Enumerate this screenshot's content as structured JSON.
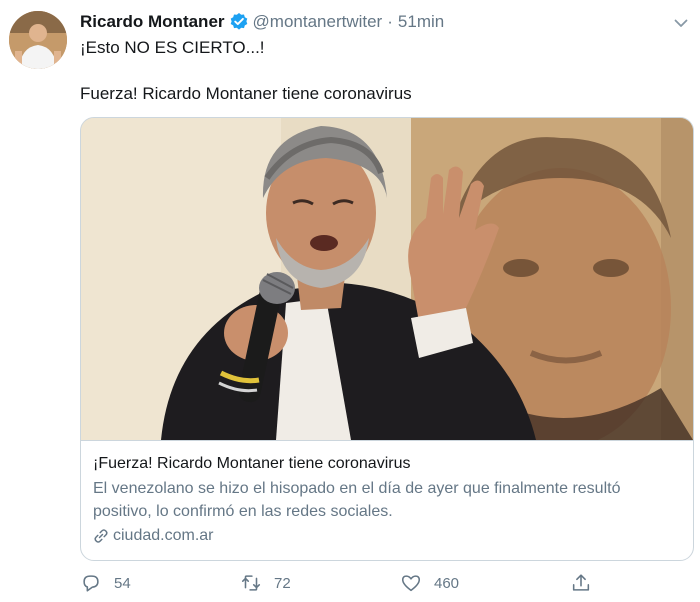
{
  "tweet": {
    "author_name": "Ricardo Montaner",
    "handle": "@montanertwiter",
    "separator": "·",
    "time": "51min",
    "line1": "¡Esto NO ES CIERTO...!",
    "line2": "Fuerza! Ricardo Montaner tiene coronavirus",
    "verified_color": "#1da1f2"
  },
  "card": {
    "title": "¡Fuerza! Ricardo Montaner tiene coronavirus",
    "description": "El venezolano se hizo el hisopado en el día de ayer que finalmente resultó positivo, lo confirmó en las redes sociales.",
    "domain": "ciudad.com.ar"
  },
  "actions": {
    "reply_count": "54",
    "retweet_count": "72",
    "like_count": "460"
  },
  "icons": [
    "verified-badge-icon",
    "chevron-down-icon",
    "link-icon",
    "reply-icon",
    "retweet-icon",
    "like-icon",
    "share-icon"
  ]
}
